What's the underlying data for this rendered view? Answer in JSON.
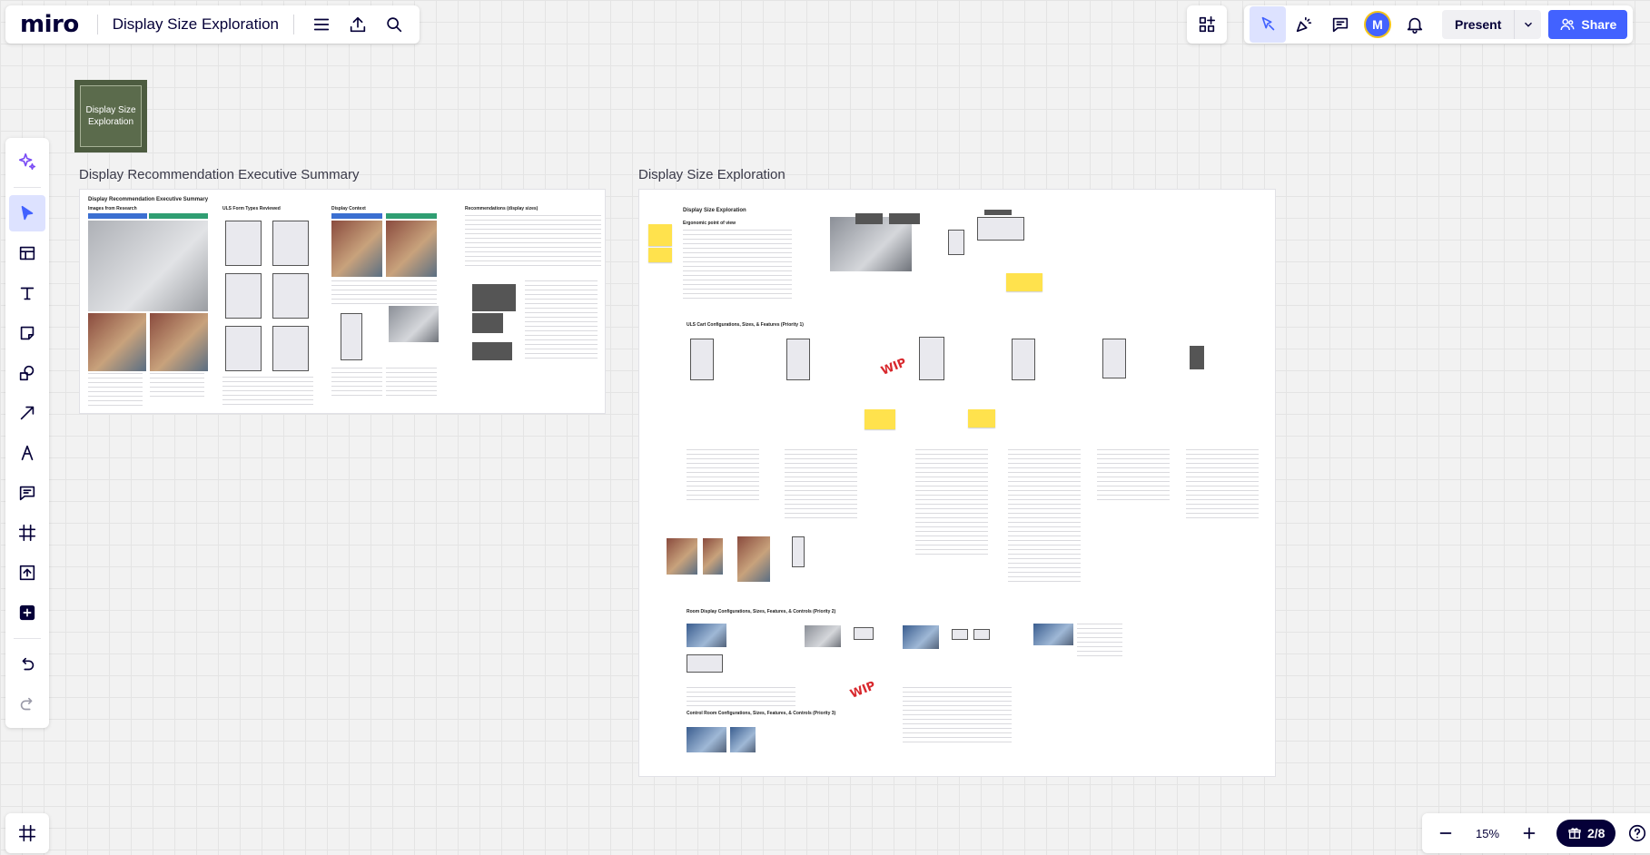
{
  "app": {
    "logo": "miro",
    "board_title": "Display Size Exploration"
  },
  "header": {
    "menu_icon": "hamburger-icon",
    "export_icon": "upload-icon",
    "search_icon": "search-icon"
  },
  "collab": {
    "apps_icon": "apps-plus-icon"
  },
  "actions": {
    "avatar_initial": "M",
    "present_label": "Present",
    "share_label": "Share"
  },
  "zoom": {
    "level": "15%",
    "page": "2/8"
  },
  "canvas": {
    "sticky_text": "Display Size Exploration",
    "frames": [
      {
        "title": "Display Recommendation Executive Summary"
      },
      {
        "title": "Display Size Exploration"
      }
    ],
    "exec_summary": {
      "heading": "Display Recommendation Executive Summary",
      "col1": "Images from Research",
      "col2": "ULS Form Types Reviewed",
      "col3": "Display Context",
      "col4": "Recommendations (display sizes)"
    },
    "exploration": {
      "heading": "Display Size Exploration",
      "subheading": "Ergonomic point of view",
      "section1": "ULS Cart Configurations, Sizes, & Features (Priority 1)",
      "section2": "Room Display Configurations, Sizes, Features, & Controls (Priority 2)",
      "section3": "Control Room Configurations, Sizes, Features, & Controls (Priority 3)",
      "wip_label": "WIP"
    }
  },
  "colors": {
    "accent": "#4262ff",
    "sticky": "#5b6b4c",
    "text": "#050038"
  }
}
